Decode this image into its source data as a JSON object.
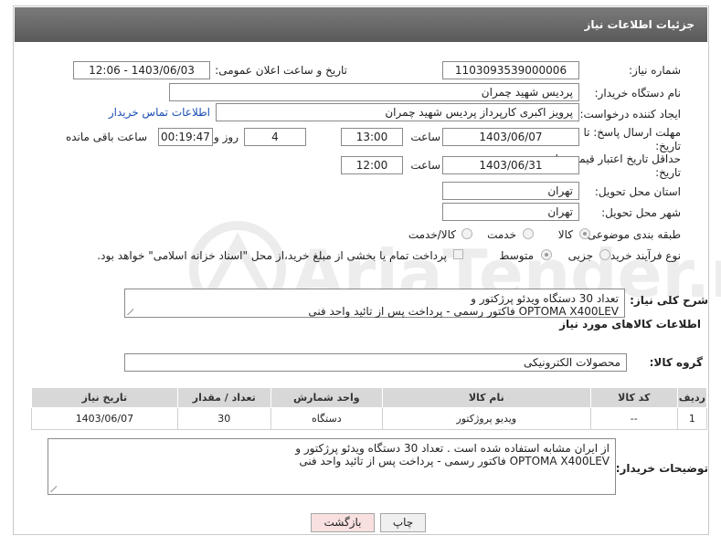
{
  "header": {
    "title": "جزئیات اطلاعات نیاز"
  },
  "fields": {
    "need_number_label": "شماره نیاز:",
    "need_number": "1103093539000006",
    "announce_label": "تاریخ و ساعت اعلان عمومی:",
    "announce_value": "1403/06/03 - 12:06",
    "buyer_org_label": "نام دستگاه خریدار:",
    "buyer_org": "پردیس شهید چمران",
    "creator_label": "ایجاد کننده درخواست:",
    "creator": "پرویز اکبری کارپرداز پردیس شهید چمران",
    "contact_link": "اطلاعات تماس خریدار",
    "deadline_label": "مهلت ارسال پاسخ: تا",
    "deadline_label2": "تاریخ:",
    "deadline_date": "1403/06/07",
    "time_label": "ساعت",
    "deadline_time": "13:00",
    "days_value": "4",
    "days_label": "روز و",
    "remaining_value": "00:19:47",
    "remaining_label": "ساعت باقی مانده",
    "validity_label": "حداقل تاریخ اعتبار قیمت: تا",
    "validity_label2": "تاریخ:",
    "validity_date": "1403/06/31",
    "validity_time_label": "ساعت",
    "validity_time": "12:00",
    "province_label": "استان محل تحویل:",
    "province": "تهران",
    "city_label": "شهر محل تحویل:",
    "city": "تهران",
    "category_label": "طبقه بندی موضوعی:",
    "category_options": [
      "کالا",
      "خدمت",
      "کالا/خدمت"
    ],
    "process_label": "نوع فرآیند خرید :",
    "process_options": [
      "جزیی",
      "متوسط"
    ],
    "payment_note": "پرداخت تمام یا بخشی از مبلغ خرید،از محل \"اسناد خزانه اسلامی\" خواهد بود."
  },
  "description": {
    "label": "شرح کلی نیاز:",
    "text": "تعداد 30 دستگاه ویدئو پرژکتور و\nOPTOMA X400LEV فاکتور رسمی - پرداخت پس از تائید واحد فنی"
  },
  "goods_info": {
    "section_title": "اطلاعات کالاهای مورد نیاز",
    "group_label": "گروه کالا:",
    "group_value": "محصولات الکترونیکی"
  },
  "table": {
    "headers": [
      "ردیف",
      "کد کالا",
      "نام کالا",
      "واحد شمارش",
      "تعداد / مقدار",
      "تاریخ نیاز"
    ],
    "rows": [
      [
        "1",
        "--",
        "ویدیو پروژکتور",
        "دستگاه",
        "30",
        "1403/06/07"
      ]
    ]
  },
  "buyer_notes": {
    "label": "توضیحات خریدار:",
    "text": "از ایران مشابه استفاده شده است . تعداد 30 دستگاه ویدئو پرژکتور و\nOPTOMA X400LEV فاکتور رسمی - پرداخت پس از تائید واحد فنی"
  },
  "buttons": {
    "print": "چاپ",
    "back": "بازگشت"
  },
  "colors": {
    "header_bg": "#6a6a6a",
    "link": "#1a4fb4",
    "back_btn_bg": "#f8e0e0",
    "print_btn_bg": "#f0f0f0"
  }
}
